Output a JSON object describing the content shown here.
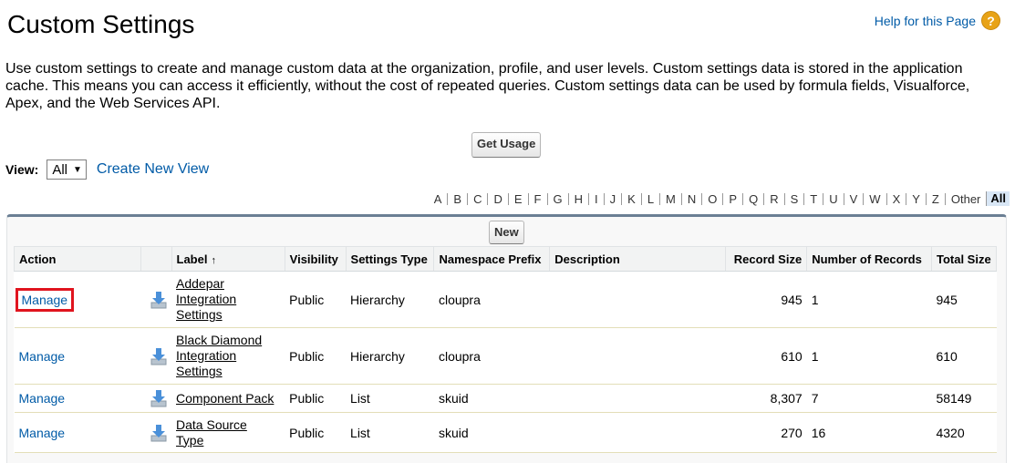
{
  "page": {
    "title": "Custom Settings",
    "help_link": "Help for this Page",
    "intro": "Use custom settings to create and manage custom data at the organization, profile, and user levels. Custom settings data is stored in the application cache. This means you can access it efficiently, without the cost of repeated queries. Custom settings data can be used by formula fields, Visualforce, Apex, and the Web Services API."
  },
  "toolbar": {
    "get_usage": "Get Usage",
    "view_label": "View:",
    "view_selected": "All",
    "create_view": "Create New View",
    "new_button": "New"
  },
  "alpha_filter": {
    "letters": [
      "A",
      "B",
      "C",
      "D",
      "E",
      "F",
      "G",
      "H",
      "I",
      "J",
      "K",
      "L",
      "M",
      "N",
      "O",
      "P",
      "Q",
      "R",
      "S",
      "T",
      "U",
      "V",
      "W",
      "X",
      "Y",
      "Z",
      "Other"
    ],
    "active": "All"
  },
  "table": {
    "columns": {
      "action": "Action",
      "label": "Label",
      "visibility": "Visibility",
      "settings_type": "Settings Type",
      "namespace_prefix": "Namespace Prefix",
      "description": "Description",
      "record_size": "Record Size",
      "number_of_records": "Number of Records",
      "total_size": "Total Size"
    },
    "rows": [
      {
        "action": "Manage",
        "label": "Addepar Integration Settings",
        "visibility": "Public",
        "settings_type": "Hierarchy",
        "namespace_prefix": "cloupra",
        "description": "",
        "record_size": "945",
        "number_of_records": "1",
        "total_size": "945"
      },
      {
        "action": "Manage",
        "label": "Black Diamond Integration Settings",
        "visibility": "Public",
        "settings_type": "Hierarchy",
        "namespace_prefix": "cloupra",
        "description": "",
        "record_size": "610",
        "number_of_records": "1",
        "total_size": "610"
      },
      {
        "action": "Manage",
        "label": "Component Pack",
        "visibility": "Public",
        "settings_type": "List",
        "namespace_prefix": "skuid",
        "description": "",
        "record_size": "8,307",
        "number_of_records": "7",
        "total_size": "58149"
      },
      {
        "action": "Manage",
        "label": "Data Source Type",
        "visibility": "Public",
        "settings_type": "List",
        "namespace_prefix": "skuid",
        "description": "",
        "record_size": "270",
        "number_of_records": "16",
        "total_size": "4320"
      }
    ]
  },
  "colors": {
    "link": "#015ba7",
    "highlight": "#e0141e",
    "header_bar": "#6b7f94"
  }
}
